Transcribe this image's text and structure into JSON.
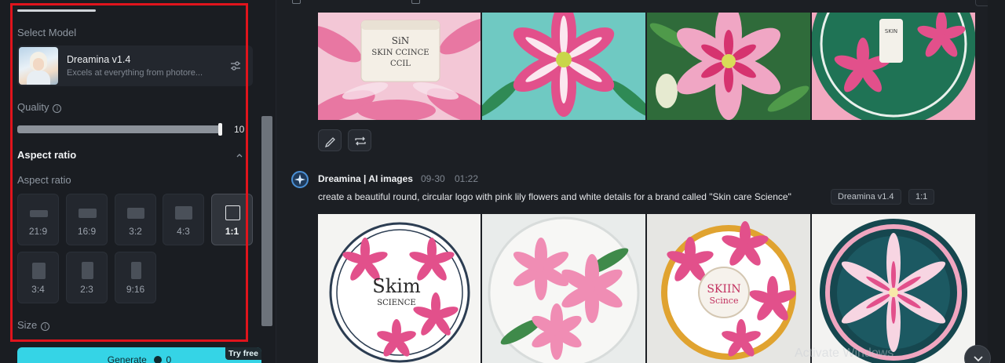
{
  "left_panel": {
    "select_model_label": "Select Model",
    "model": {
      "name": "Dreamina v1.4",
      "description": "Excels at everything from photore..."
    },
    "quality_label": "Quality",
    "quality_value": "10",
    "quality_fraction": 1.0,
    "aspect_heading": "Aspect ratio",
    "aspect_label": "Aspect ratio",
    "ratios": [
      "21:9",
      "16:9",
      "3:2",
      "4:3",
      "1:1",
      "3:4",
      "2:3",
      "9:16"
    ],
    "selected_ratio": "1:1",
    "size_label": "Size",
    "generate": {
      "label": "Generate",
      "credits": "0",
      "badge": "Try free"
    }
  },
  "feed": {
    "message": {
      "author": "Dreamina | AI images",
      "date": "09-30",
      "time": "01:22",
      "prompt": "create a beautiful round, circular logo with pink lily flowers and white details for a brand called \"Skin care Science\"",
      "tags": [
        "Dreamina v1.4",
        "1:1"
      ]
    },
    "row1_images": [
      "lily-jar-closeup",
      "lily-teal-background",
      "lily-buds-green",
      "lily-green-circle-jar"
    ],
    "row1_jar_text": [
      "SiN",
      "SKIN CCINCE",
      "CCIL",
      "SKIN"
    ],
    "row2_images": [
      "lily-circle-logo-white",
      "lily-plate-white",
      "lily-gold-ring-jar",
      "lily-teal-pink-ring"
    ],
    "row2_logo_text": [
      "Skim",
      "SCIENCE",
      "SKIIN",
      "Scince"
    ],
    "watermark": "Activate Windows",
    "colors": {
      "accent": "#35d4e6",
      "highlight_outline": "#e0141c",
      "lily_pink": "#e2508b"
    }
  }
}
